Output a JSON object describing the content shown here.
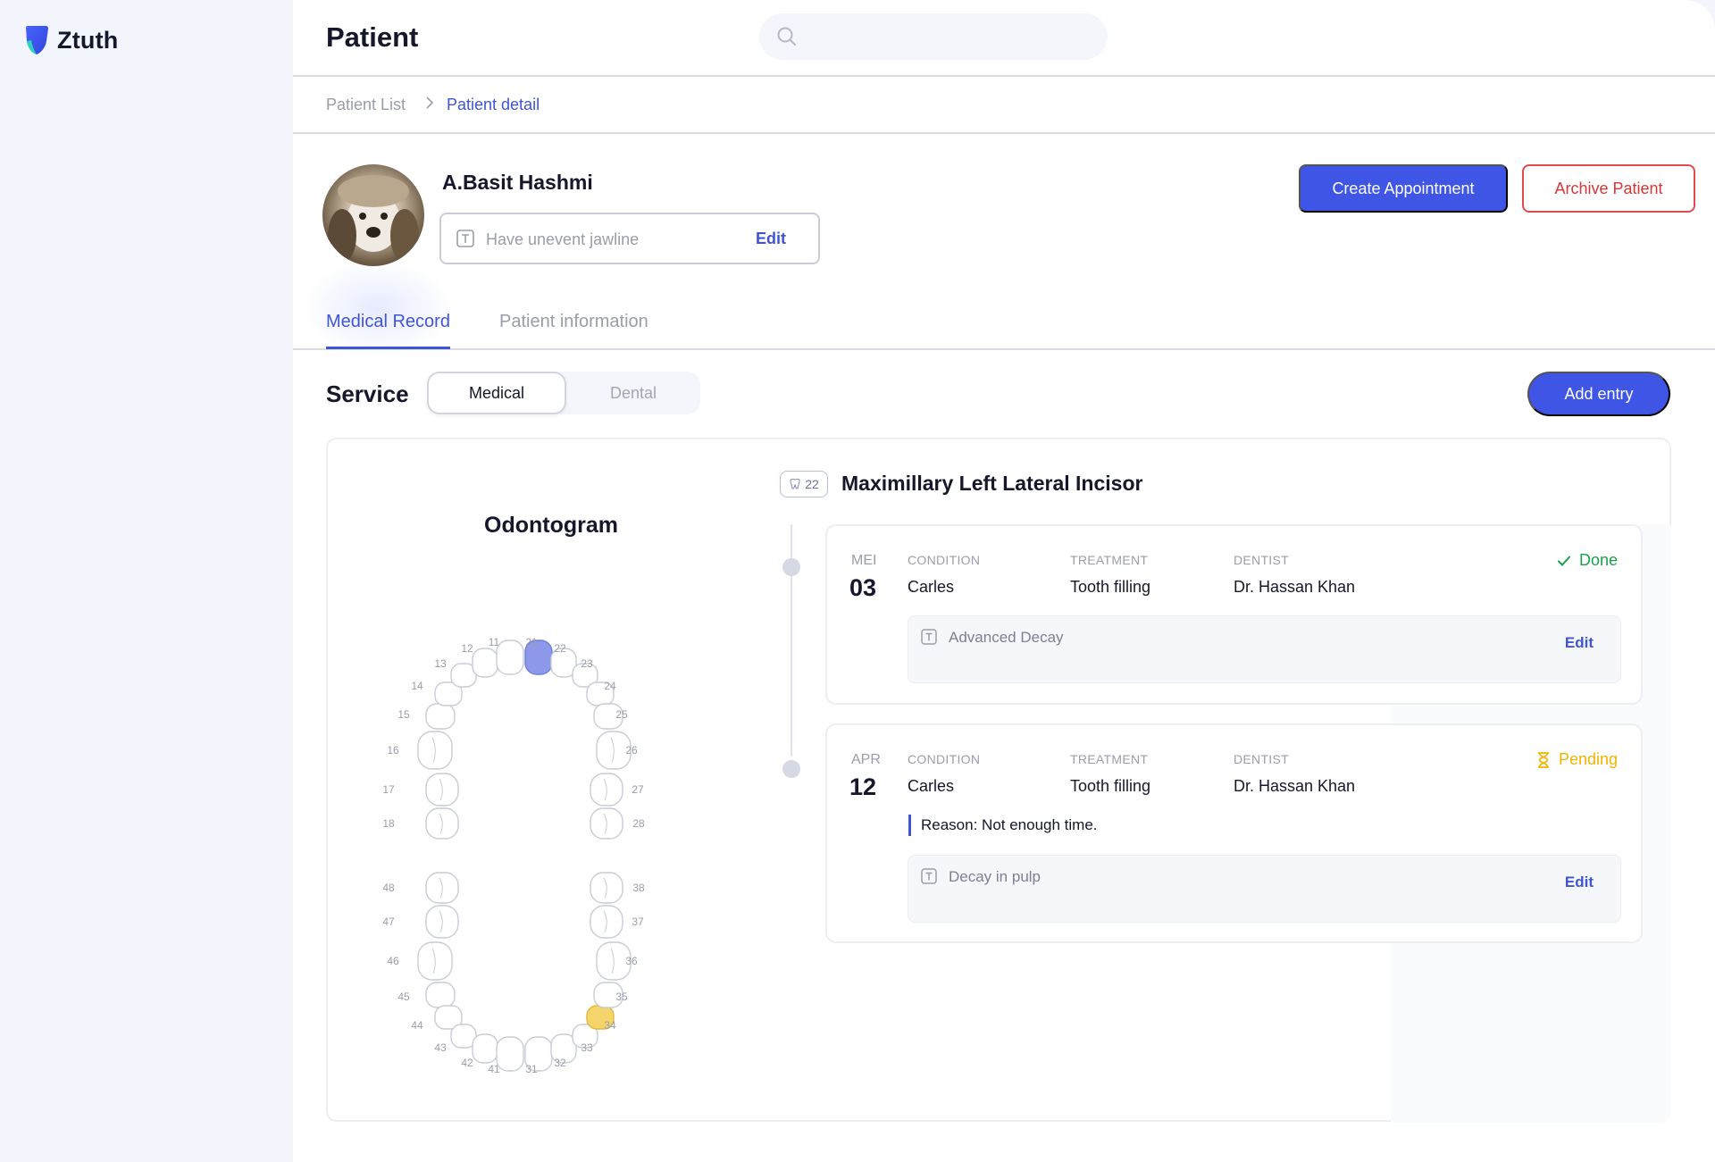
{
  "app": {
    "name": "Ztuth",
    "brand_color": "#3f55e6"
  },
  "header": {
    "title": "Patient",
    "search_placeholder": ""
  },
  "breadcrumb": {
    "items": [
      "Patient List",
      "Patient detail"
    ]
  },
  "patient": {
    "name": "A.Basit Hashmi",
    "note": "Have unevent jawline",
    "note_edit": "Edit"
  },
  "actions": {
    "create": "Create Appointment",
    "archive": "Archive Patient"
  },
  "tabs": {
    "active": "Medical Record",
    "inactive": "Patient information"
  },
  "service": {
    "label": "Service",
    "segments": [
      "Medical",
      "Dental"
    ],
    "selected": "Medical",
    "add": "Add entry"
  },
  "odontogram": {
    "title": "Odontogram",
    "upper_labels": [
      "18",
      "17",
      "16",
      "15",
      "14",
      "13",
      "12",
      "11",
      "21",
      "22",
      "23",
      "24",
      "25",
      "26",
      "27",
      "28"
    ],
    "lower_labels": [
      "48",
      "47",
      "46",
      "45",
      "44",
      "43",
      "42",
      "41",
      "31",
      "32",
      "33",
      "34",
      "35",
      "36",
      "37",
      "38"
    ],
    "selected_tooth": "21",
    "selected_color": "#8d99e8",
    "flagged_tooth": "34",
    "flagged_color": "#f5d56b"
  },
  "tooth": {
    "number": "22",
    "name": "Maximillary Left Lateral Incisor"
  },
  "entries": [
    {
      "month": "MEI",
      "day": "03",
      "condition_label": "CONDITION",
      "condition": "Carles",
      "treatment_label": "TREATMENT",
      "treatment": "Tooth filling",
      "dentist_label": "DENTIST",
      "dentist": "Dr. Hassan Khan",
      "status": "Done",
      "status_color": "#17a34a",
      "note": "Advanced Decay",
      "edit": "Edit"
    },
    {
      "month": "APR",
      "day": "12",
      "condition_label": "CONDITION",
      "condition": "Carles",
      "treatment_label": "TREATMENT",
      "treatment": "Tooth filling",
      "dentist_label": "DENTIST",
      "dentist": "Dr. Hassan Khan",
      "status": "Pending",
      "status_color": "#f0b400",
      "reason": "Reason: Not enough time.",
      "note": "Decay in pulp",
      "edit": "Edit"
    }
  ]
}
